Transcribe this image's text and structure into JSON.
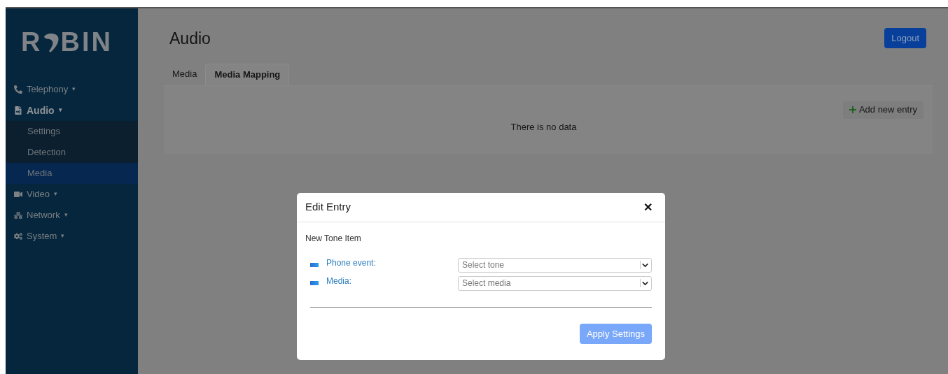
{
  "logo": {
    "before": "R",
    "after": "BIN"
  },
  "sidebar": {
    "items": [
      {
        "label": "Telephony",
        "caret": "▾",
        "expanded": false
      },
      {
        "label": "Audio",
        "caret": "▾",
        "expanded": true,
        "children": [
          {
            "label": "Settings",
            "selected": false
          },
          {
            "label": "Detection",
            "selected": false
          },
          {
            "label": "Media",
            "selected": true
          }
        ]
      },
      {
        "label": "Video",
        "caret": "▾",
        "expanded": false
      },
      {
        "label": "Network",
        "caret": "▾",
        "expanded": false
      },
      {
        "label": "System",
        "caret": "▾",
        "expanded": false
      }
    ]
  },
  "page_title": "Audio",
  "logout_button": "Logout",
  "tabs": [
    {
      "label": "Media",
      "selected": false
    },
    {
      "label": "Media Mapping",
      "selected": true
    }
  ],
  "add_button": "Add new entry",
  "empty_message": "There is no data",
  "dialog": {
    "title": "Edit Entry",
    "close": "✕",
    "subtitle": "New Tone Item",
    "fields": [
      {
        "label": "Phone event:",
        "placeholder": "Select tone"
      },
      {
        "label": "Media:",
        "placeholder": "Select media"
      }
    ],
    "apply_button": "Apply Settings"
  }
}
